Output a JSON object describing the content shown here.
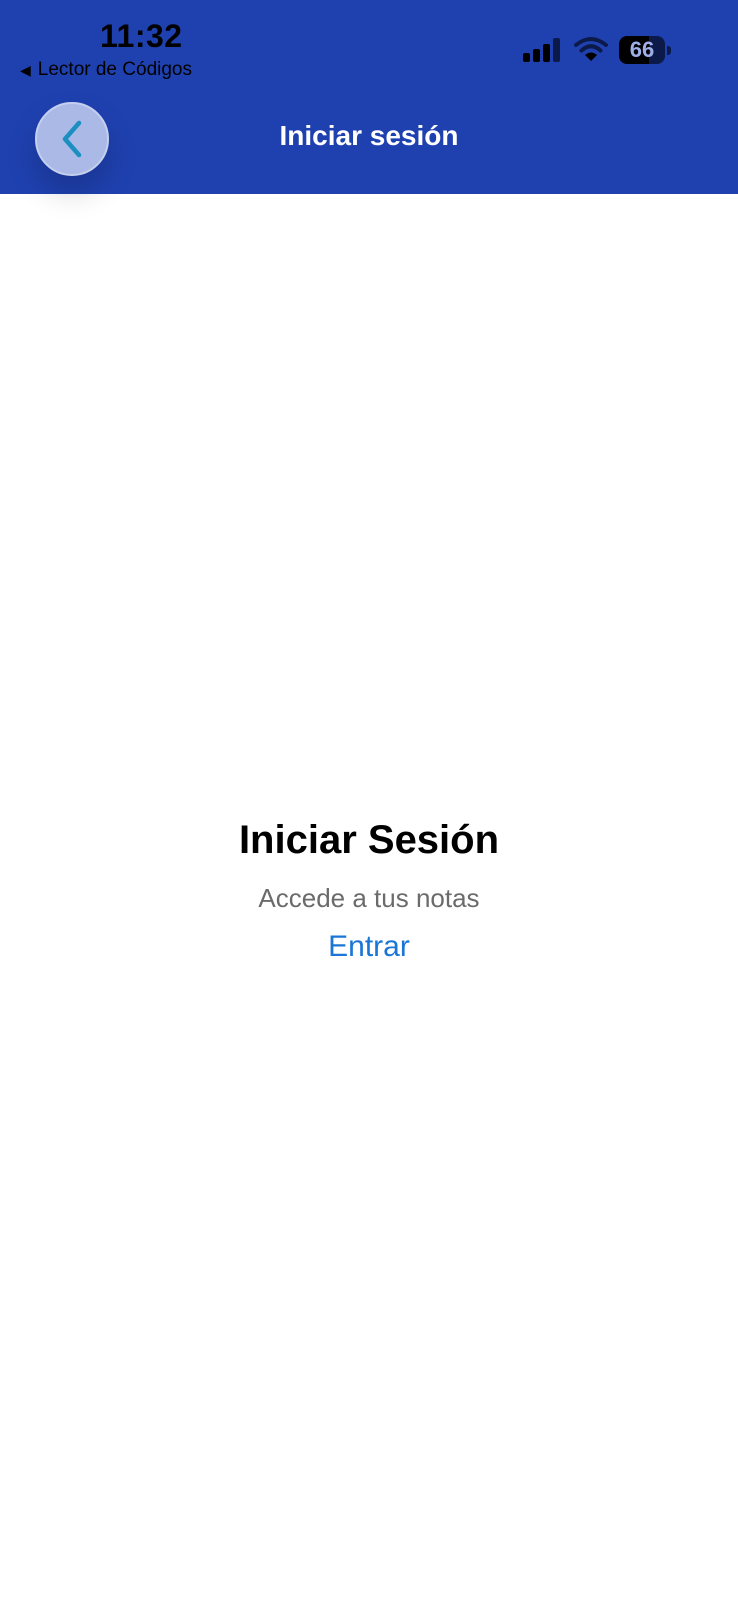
{
  "status_bar": {
    "time": "11:32",
    "back_app_label": "Lector de Códigos",
    "battery_level": "66",
    "battery_percent": 66
  },
  "nav_bar": {
    "title": "Iniciar sesión",
    "background_color": "#1f41b0",
    "back_icon": "chevron-left-icon"
  },
  "main": {
    "title": "Iniciar Sesión",
    "subtitle": "Accede a tus notas",
    "link_label": "Entrar",
    "link_color": "#1a76d6"
  }
}
